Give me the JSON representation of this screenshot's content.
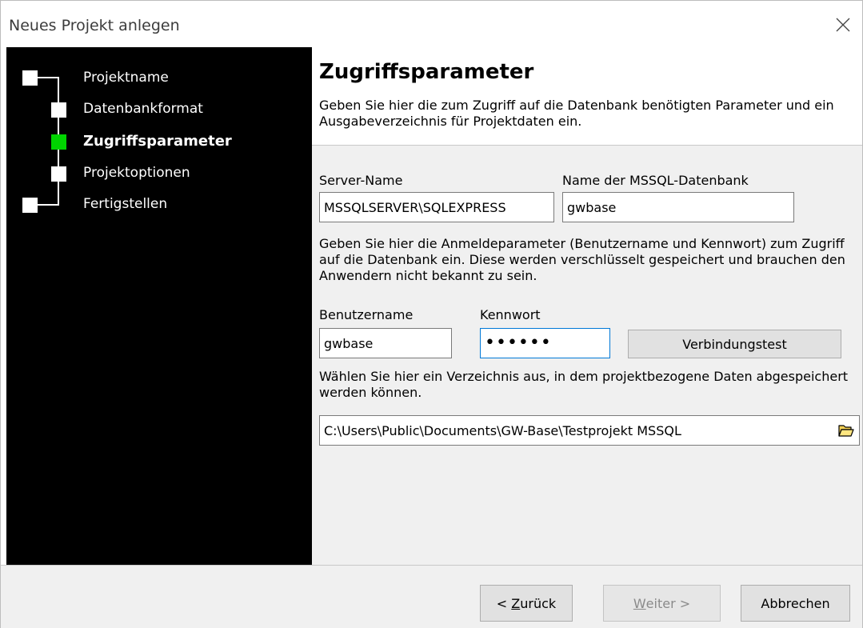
{
  "window": {
    "title": "Neues Projekt anlegen"
  },
  "sidebar": {
    "steps": [
      {
        "label": "Projektname",
        "state": "done"
      },
      {
        "label": "Datenbankformat",
        "state": "done"
      },
      {
        "label": "Zugriffsparameter",
        "state": "active"
      },
      {
        "label": "Projektoptionen",
        "state": "pending"
      },
      {
        "label": "Fertigstellen",
        "state": "pending"
      }
    ],
    "active_color": "#00d400"
  },
  "header": {
    "title": "Zugriffsparameter",
    "description": "Geben Sie hier die zum Zugriff auf die Datenbank benötigten Parameter und ein Ausgabeverzeichnis für Projektdaten ein."
  },
  "form": {
    "server_label": "Server-Name",
    "server_value": "MSSQLSERVER\\SQLEXPRESS",
    "db_label": "Name der MSSQL-Datenbank",
    "db_value": "gwbase",
    "credentials_info": "Geben Sie hier die Anmeldeparameter (Benutzername und Kennwort) zum Zugriff auf die Datenbank ein. Diese werden verschlüsselt gespeichert und brauchen den Anwendern nicht bekannt zu sein.",
    "user_label": "Benutzername",
    "user_value": "gwbase",
    "password_label": "Kennwort",
    "password_display": "••••••",
    "test_button": "Verbindungstest",
    "dir_info": "Wählen Sie hier ein Verzeichnis aus, in dem projektbezogene Daten abgespeichert werden können.",
    "dir_value": "C:\\Users\\Public\\Documents\\GW-Base\\Testprojekt MSSQL",
    "browse_icon": "folder-open-icon"
  },
  "footer": {
    "back_mnemonic": "Z",
    "back_rest": "urück",
    "back_prefix": "< ",
    "next_mnemonic": "W",
    "next_rest": "eiter >",
    "cancel": "Abbrechen"
  }
}
